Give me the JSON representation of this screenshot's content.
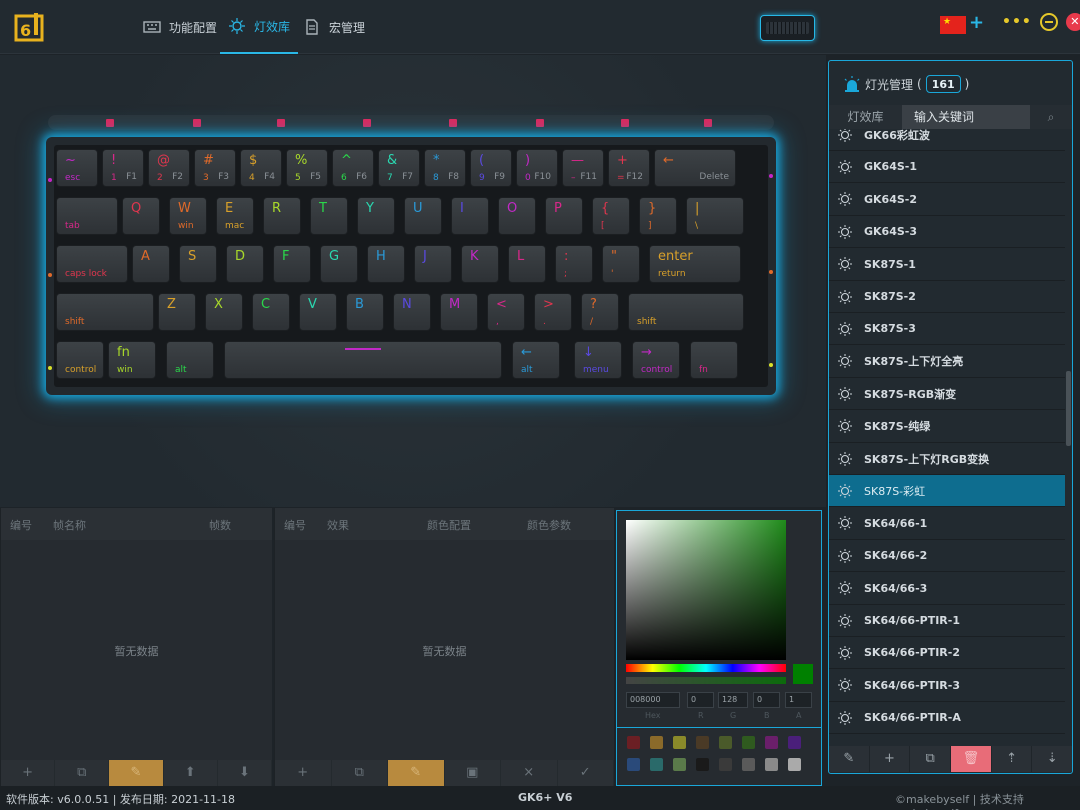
{
  "header": {
    "tabs": [
      {
        "label": "功能配置",
        "icon": "keyboard-icon"
      },
      {
        "label": "灯效库",
        "icon": "light-bulb-icon"
      },
      {
        "label": "宏管理",
        "icon": "document-icon"
      }
    ],
    "active_tab": 1,
    "language_flag": "flag-cn-icon"
  },
  "keyboard": {
    "rows": [
      [
        [
          "~",
          "esc",
          ""
        ],
        [
          "!",
          "1",
          "F1"
        ],
        [
          "@",
          "2",
          "F2"
        ],
        [
          "#",
          "3",
          "F3"
        ],
        [
          "$",
          "4",
          "F4"
        ],
        [
          "%",
          "5",
          "F5"
        ],
        [
          "^",
          "6",
          "F6"
        ],
        [
          "&",
          "7",
          "F7"
        ],
        [
          "*",
          "8",
          "F8"
        ],
        [
          "(",
          "9",
          "F9"
        ],
        [
          ")",
          "0",
          "F10"
        ],
        [
          "—",
          "–",
          "F11"
        ],
        [
          "+",
          "=",
          "F12"
        ],
        [
          "←",
          "",
          "Delete"
        ]
      ],
      [
        [
          "",
          "tab",
          ""
        ],
        [
          "Q",
          "",
          ""
        ],
        [
          "W",
          "win",
          ""
        ],
        [
          "E",
          "mac",
          ""
        ],
        [
          "R",
          "",
          ""
        ],
        [
          "T",
          "",
          ""
        ],
        [
          "Y",
          "",
          ""
        ],
        [
          "U",
          "",
          ""
        ],
        [
          "I",
          "",
          ""
        ],
        [
          "O",
          "",
          ""
        ],
        [
          "P",
          "",
          ""
        ],
        [
          "{",
          "[",
          ""
        ],
        [
          "}",
          "]",
          ""
        ],
        [
          "|",
          "\\",
          ""
        ]
      ],
      [
        [
          "",
          "caps lock",
          ""
        ],
        [
          "A",
          "",
          ""
        ],
        [
          "S",
          "",
          ""
        ],
        [
          "D",
          "",
          ""
        ],
        [
          "F",
          "",
          ""
        ],
        [
          "G",
          "",
          ""
        ],
        [
          "H",
          "",
          ""
        ],
        [
          "J",
          "",
          ""
        ],
        [
          "K",
          "",
          ""
        ],
        [
          "L",
          "",
          ""
        ],
        [
          ":",
          ";",
          ""
        ],
        [
          "\"",
          "'",
          ""
        ],
        [
          "enter",
          "return",
          ""
        ]
      ],
      [
        [
          "",
          "shift",
          ""
        ],
        [
          "Z",
          "",
          ""
        ],
        [
          "X",
          "",
          ""
        ],
        [
          "C",
          "",
          ""
        ],
        [
          "V",
          "",
          ""
        ],
        [
          "B",
          "",
          ""
        ],
        [
          "N",
          "",
          ""
        ],
        [
          "M",
          "",
          ""
        ],
        [
          "<",
          ",",
          ""
        ],
        [
          ">",
          ".",
          ""
        ],
        [
          "?",
          "/",
          ""
        ],
        [
          "",
          "shift",
          ""
        ]
      ],
      [
        [
          "",
          "control",
          ""
        ],
        [
          "fn",
          "win",
          ""
        ],
        [
          "",
          "alt",
          ""
        ],
        [
          "",
          "",
          ""
        ],
        [
          "←",
          "alt",
          ""
        ],
        [
          "↓",
          "menu",
          ""
        ],
        [
          "→",
          "control",
          ""
        ],
        [
          "",
          "fn",
          ""
        ]
      ]
    ]
  },
  "effects_table": {
    "columns": [
      "编号",
      "帧名称",
      "帧数"
    ],
    "empty_text": "暂无数据",
    "footer": [
      "+",
      "⧉",
      "✎",
      "⬆",
      "⬇"
    ]
  },
  "effect_config_table": {
    "columns": [
      "编号",
      "效果",
      "颜色配置",
      "颜色参数"
    ],
    "empty_text": "暂无数据",
    "footer": [
      "+",
      "⧉",
      "✎",
      "▣",
      "×",
      "✓"
    ]
  },
  "color_picker": {
    "hex": "008000",
    "r": "0",
    "g": "128",
    "b": "0",
    "a": "1",
    "labels": [
      "Hex",
      "R",
      "G",
      "B",
      "A"
    ],
    "current_color": "#008000",
    "swatches": [
      "#6b1f24",
      "#8a6a2a",
      "#8a8a2a",
      "#4a3a26",
      "#4a5a2a",
      "#2f5a1f",
      "#6a1f6a",
      "#4a1f7a",
      "#2a4a7a",
      "#2a6a6a",
      "#5a7a4a",
      "#1a1a1a",
      "#3a3a3a",
      "#5a5a5a",
      "#8a8a8a",
      "#aaaaaa"
    ]
  },
  "light_panel": {
    "title": "灯光管理",
    "count": "161",
    "tabs": [
      "灯效库",
      "输入关键词"
    ],
    "search_placeholder": "输入关键词",
    "items": [
      "GK66彩虹波",
      "GK64S-1",
      "GK64S-2",
      "GK64S-3",
      "SK87S-1",
      "SK87S-2",
      "SK87S-3",
      "SK87S-上下灯全亮",
      "SK87S-RGB渐变",
      "SK87S-纯绿",
      "SK87S-上下灯RGB变换",
      "SK87S-彩虹",
      "SK64/66-1",
      "SK64/66-2",
      "SK64/66-3",
      "SK64/66-PTIR-1",
      "SK64/66-PTIR-2",
      "SK64/66-PTIR-3",
      "SK64/66-PTIR-A"
    ],
    "selected_index": 11,
    "footer": [
      "✎",
      "+",
      "⧉",
      "🗑",
      "⇡",
      "⇣"
    ]
  },
  "status": {
    "left": "软件版本: v6.0.0.51 | 发布日期: 2021-11-18",
    "center": "GK6+ V6",
    "right": "©makebyself | 技术支持 makebyself"
  },
  "colors": {
    "accent": "#1aa7d9",
    "led_pink": "#e22459",
    "selected_row": "#0e6d8f"
  }
}
